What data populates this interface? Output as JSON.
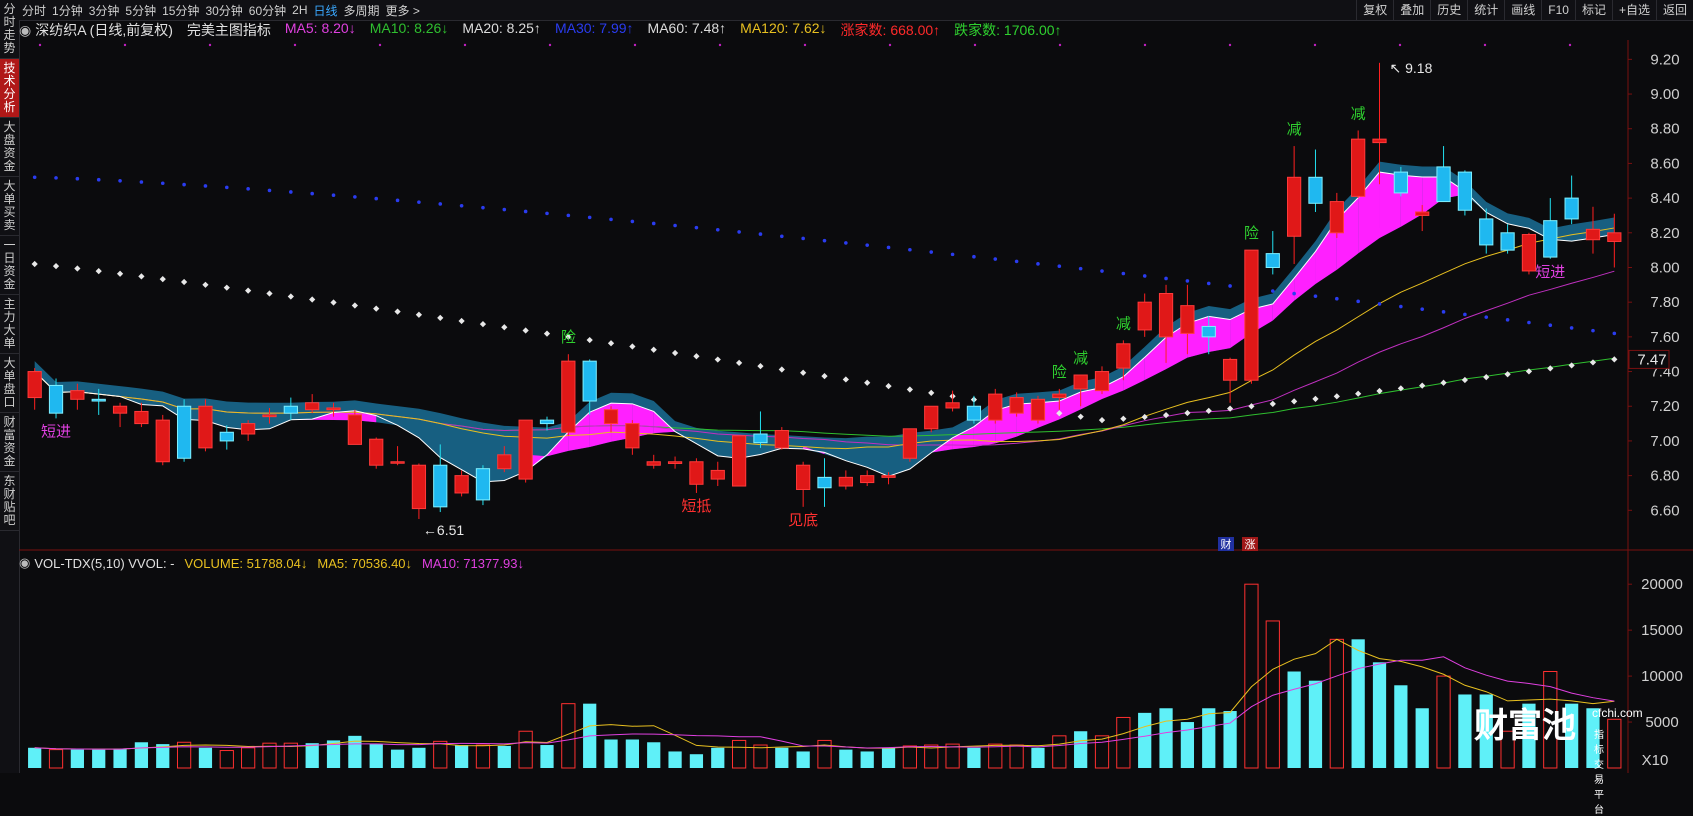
{
  "sidebar": {
    "items": [
      {
        "label": "分时走势",
        "active": false
      },
      {
        "label": "技术分析",
        "active": true
      },
      {
        "label": "大盘资金",
        "active": false
      },
      {
        "label": "大单买卖",
        "active": false
      },
      {
        "label": "一日资金",
        "active": false
      },
      {
        "label": "主力大单",
        "active": false
      },
      {
        "label": "大单盘口",
        "active": false
      },
      {
        "label": "财富资金",
        "active": false
      },
      {
        "label": "东财贴吧",
        "active": false
      }
    ]
  },
  "toolbar": {
    "periods": [
      "分时",
      "1分钟",
      "3分钟",
      "5分钟",
      "15分钟",
      "30分钟",
      "60分钟",
      "2H",
      "日线",
      "多周期",
      "更多 >"
    ],
    "active_period": "日线",
    "right_tools": [
      "复权",
      "叠加",
      "历史",
      "统计",
      "画线",
      "F10",
      "标记",
      "+自选",
      "返回"
    ]
  },
  "legend": {
    "stock": "深纺织A (日线,前复权)",
    "indicator": "完美主图指标",
    "items": [
      {
        "text": "MA5: 8.20↓",
        "color": "#e040e0"
      },
      {
        "text": "MA10: 8.26↓",
        "color": "#2fbf2f"
      },
      {
        "text": "MA20: 8.25↑",
        "color": "#dcdcdc"
      },
      {
        "text": "MA30: 7.99↑",
        "color": "#2a3cf0"
      },
      {
        "text": "MA60: 7.48↑",
        "color": "#dcdcdc"
      },
      {
        "text": "MA120: 7.62↓",
        "color": "#e8c020"
      },
      {
        "text": "涨家数: 668.00↑",
        "color": "#ff2a2a"
      },
      {
        "text": "跌家数: 1706.00↑",
        "color": "#2fd02f"
      }
    ]
  },
  "vol_legend": {
    "title": "VOL-TDX(5,10) VVOL: -",
    "items": [
      {
        "text": "VOLUME: 51788.04↓",
        "color": "#e8c020"
      },
      {
        "text": "MA5: 70536.40↓",
        "color": "#e8c020"
      },
      {
        "text": "MA10: 71377.93↓",
        "color": "#e040e0"
      }
    ]
  },
  "chart_data": [
    {
      "type": "candlestick",
      "ylim": [
        6.4,
        9.3
      ],
      "y_ticks": [
        "9.20",
        "9.00",
        "8.80",
        "8.60",
        "8.40",
        "8.20",
        "8.00",
        "7.80",
        "7.60",
        "7.40",
        "7.20",
        "7.00",
        "6.80",
        "6.60"
      ],
      "last_price_label": "7.47",
      "high_label": "9.18",
      "low_label": "6.51",
      "candles": [
        {
          "o": 7.25,
          "h": 7.42,
          "l": 7.18,
          "c": 7.4
        },
        {
          "o": 7.32,
          "h": 7.36,
          "l": 7.13,
          "c": 7.16
        },
        {
          "o": 7.24,
          "h": 7.33,
          "l": 7.18,
          "c": 7.29
        },
        {
          "o": 7.24,
          "h": 7.3,
          "l": 7.15,
          "c": 7.23
        },
        {
          "o": 7.16,
          "h": 7.22,
          "l": 7.08,
          "c": 7.2
        },
        {
          "o": 7.1,
          "h": 7.22,
          "l": 7.08,
          "c": 7.17
        },
        {
          "o": 6.88,
          "h": 7.15,
          "l": 6.86,
          "c": 7.12
        },
        {
          "o": 7.2,
          "h": 7.24,
          "l": 6.88,
          "c": 6.9
        },
        {
          "o": 6.96,
          "h": 7.24,
          "l": 6.94,
          "c": 7.2
        },
        {
          "o": 7.05,
          "h": 7.09,
          "l": 6.95,
          "c": 7.0
        },
        {
          "o": 7.04,
          "h": 7.12,
          "l": 7.0,
          "c": 7.1
        },
        {
          "o": 7.14,
          "h": 7.19,
          "l": 7.1,
          "c": 7.15
        },
        {
          "o": 7.2,
          "h": 7.25,
          "l": 7.12,
          "c": 7.16
        },
        {
          "o": 7.18,
          "h": 7.27,
          "l": 7.16,
          "c": 7.22
        },
        {
          "o": 7.18,
          "h": 7.22,
          "l": 7.14,
          "c": 7.19
        },
        {
          "o": 6.98,
          "h": 7.18,
          "l": 6.98,
          "c": 7.15
        },
        {
          "o": 6.86,
          "h": 7.02,
          "l": 6.84,
          "c": 7.01
        },
        {
          "o": 6.88,
          "h": 6.97,
          "l": 6.86,
          "c": 6.88
        },
        {
          "o": 6.61,
          "h": 6.87,
          "l": 6.55,
          "c": 6.86
        },
        {
          "o": 6.86,
          "h": 6.98,
          "l": 6.59,
          "c": 6.62
        },
        {
          "o": 6.7,
          "h": 6.83,
          "l": 6.68,
          "c": 6.8
        },
        {
          "o": 6.84,
          "h": 6.86,
          "l": 6.63,
          "c": 6.66
        },
        {
          "o": 6.84,
          "h": 6.97,
          "l": 6.82,
          "c": 6.92
        },
        {
          "o": 6.78,
          "h": 7.12,
          "l": 6.76,
          "c": 7.12
        },
        {
          "o": 7.12,
          "h": 7.14,
          "l": 7.06,
          "c": 7.1
        },
        {
          "o": 7.05,
          "h": 7.5,
          "l": 7.03,
          "c": 7.46
        },
        {
          "o": 7.46,
          "h": 7.47,
          "l": 7.15,
          "c": 7.23
        },
        {
          "o": 7.1,
          "h": 7.2,
          "l": 7.05,
          "c": 7.18
        },
        {
          "o": 6.96,
          "h": 7.12,
          "l": 6.92,
          "c": 7.1
        },
        {
          "o": 6.86,
          "h": 6.92,
          "l": 6.84,
          "c": 6.88
        },
        {
          "o": 6.87,
          "h": 6.91,
          "l": 6.84,
          "c": 6.88
        },
        {
          "o": 6.75,
          "h": 6.9,
          "l": 6.7,
          "c": 6.88
        },
        {
          "o": 6.78,
          "h": 6.88,
          "l": 6.74,
          "c": 6.83
        },
        {
          "o": 6.74,
          "h": 7.03,
          "l": 6.74,
          "c": 7.03
        },
        {
          "o": 7.04,
          "h": 7.17,
          "l": 6.96,
          "c": 6.99
        },
        {
          "o": 6.96,
          "h": 7.08,
          "l": 6.95,
          "c": 7.06
        },
        {
          "o": 6.72,
          "h": 6.88,
          "l": 6.62,
          "c": 6.86
        },
        {
          "o": 6.79,
          "h": 6.9,
          "l": 6.62,
          "c": 6.73
        },
        {
          "o": 6.74,
          "h": 6.83,
          "l": 6.72,
          "c": 6.79
        },
        {
          "o": 6.76,
          "h": 6.83,
          "l": 6.74,
          "c": 6.8
        },
        {
          "o": 6.79,
          "h": 6.82,
          "l": 6.75,
          "c": 6.8
        },
        {
          "o": 6.9,
          "h": 7.07,
          "l": 6.88,
          "c": 7.07
        },
        {
          "o": 7.07,
          "h": 7.2,
          "l": 7.05,
          "c": 7.2
        },
        {
          "o": 7.19,
          "h": 7.29,
          "l": 7.17,
          "c": 7.22
        },
        {
          "o": 7.2,
          "h": 7.26,
          "l": 7.1,
          "c": 7.12
        },
        {
          "o": 7.12,
          "h": 7.3,
          "l": 7.1,
          "c": 7.27
        },
        {
          "o": 7.16,
          "h": 7.28,
          "l": 7.14,
          "c": 7.25
        },
        {
          "o": 7.12,
          "h": 7.26,
          "l": 7.1,
          "c": 7.24
        },
        {
          "o": 7.25,
          "h": 7.3,
          "l": 7.18,
          "c": 7.27
        },
        {
          "o": 7.3,
          "h": 7.38,
          "l": 7.2,
          "c": 7.38
        },
        {
          "o": 7.29,
          "h": 7.43,
          "l": 7.27,
          "c": 7.4
        },
        {
          "o": 7.42,
          "h": 7.58,
          "l": 7.35,
          "c": 7.56
        },
        {
          "o": 7.64,
          "h": 7.85,
          "l": 7.6,
          "c": 7.8
        },
        {
          "o": 7.6,
          "h": 7.9,
          "l": 7.45,
          "c": 7.85
        },
        {
          "o": 7.62,
          "h": 7.9,
          "l": 7.5,
          "c": 7.78
        },
        {
          "o": 7.66,
          "h": 7.72,
          "l": 7.5,
          "c": 7.6
        },
        {
          "o": 7.35,
          "h": 7.48,
          "l": 7.22,
          "c": 7.47
        },
        {
          "o": 7.35,
          "h": 8.1,
          "l": 7.33,
          "c": 8.1
        },
        {
          "o": 8.08,
          "h": 8.21,
          "l": 7.96,
          "c": 8.0
        },
        {
          "o": 8.18,
          "h": 8.7,
          "l": 8.02,
          "c": 8.52
        },
        {
          "o": 8.52,
          "h": 8.68,
          "l": 8.32,
          "c": 8.37
        },
        {
          "o": 8.2,
          "h": 8.43,
          "l": 8.17,
          "c": 8.38
        },
        {
          "o": 8.41,
          "h": 8.79,
          "l": 8.4,
          "c": 8.74
        },
        {
          "o": 8.72,
          "h": 9.18,
          "l": 8.48,
          "c": 8.74
        },
        {
          "o": 8.55,
          "h": 8.58,
          "l": 8.41,
          "c": 8.43
        },
        {
          "o": 8.3,
          "h": 8.36,
          "l": 8.21,
          "c": 8.32
        },
        {
          "o": 8.58,
          "h": 8.7,
          "l": 8.4,
          "c": 8.38
        },
        {
          "o": 8.55,
          "h": 8.56,
          "l": 8.3,
          "c": 8.33
        },
        {
          "o": 8.28,
          "h": 8.34,
          "l": 8.08,
          "c": 8.13
        },
        {
          "o": 8.2,
          "h": 8.25,
          "l": 8.08,
          "c": 8.1
        },
        {
          "o": 7.98,
          "h": 8.2,
          "l": 7.96,
          "c": 8.19
        },
        {
          "o": 8.27,
          "h": 8.4,
          "l": 8.05,
          "c": 8.06
        },
        {
          "o": 8.4,
          "h": 8.53,
          "l": 8.25,
          "c": 8.28
        },
        {
          "o": 8.16,
          "h": 8.35,
          "l": 8.08,
          "c": 8.22
        },
        {
          "o": 8.15,
          "h": 8.31,
          "l": 8.0,
          "c": 8.2
        }
      ],
      "annotations": [
        {
          "i": 1,
          "text": "短进",
          "color": "#e040e0",
          "pos": "below"
        },
        {
          "i": 25,
          "text": "险",
          "color": "#2fd02f",
          "pos": "above"
        },
        {
          "i": 31,
          "text": "短抵",
          "color": "#ff3030",
          "pos": "below"
        },
        {
          "i": 36,
          "text": "见底",
          "color": "#ff3030",
          "pos": "below"
        },
        {
          "i": 48,
          "text": "险",
          "color": "#2fd02f",
          "pos": "above"
        },
        {
          "i": 49,
          "text": "减",
          "color": "#2fd02f",
          "pos": "above"
        },
        {
          "i": 51,
          "text": "减",
          "color": "#2fd02f",
          "pos": "above"
        },
        {
          "i": 57,
          "text": "险",
          "color": "#2fd02f",
          "pos": "above"
        },
        {
          "i": 59,
          "text": "减",
          "color": "#2fd02f",
          "pos": "above"
        },
        {
          "i": 62,
          "text": "减",
          "color": "#2fd02f",
          "pos": "above"
        },
        {
          "i": 71,
          "text": "短进",
          "color": "#e040e0",
          "pos": "below"
        }
      ],
      "markers": [
        "财",
        "涨"
      ]
    },
    {
      "type": "bar",
      "ylim": [
        0,
        21000
      ],
      "y_ticks": [
        "20000",
        "15000",
        "10000",
        "5000"
      ],
      "unit_label": "X10",
      "volumes": [
        [
          2200,
          0
        ],
        [
          2000,
          1
        ],
        [
          2000,
          0
        ],
        [
          2000,
          0
        ],
        [
          2100,
          0
        ],
        [
          2800,
          0
        ],
        [
          2600,
          0
        ],
        [
          2800,
          1
        ],
        [
          2200,
          0
        ],
        [
          1900,
          1
        ],
        [
          2200,
          1
        ],
        [
          2700,
          1
        ],
        [
          2700,
          1
        ],
        [
          2700,
          0
        ],
        [
          3000,
          0
        ],
        [
          3500,
          0
        ],
        [
          2600,
          0
        ],
        [
          2000,
          0
        ],
        [
          2200,
          0
        ],
        [
          2900,
          1
        ],
        [
          2500,
          0
        ],
        [
          2500,
          1
        ],
        [
          2400,
          0
        ],
        [
          4000,
          1
        ],
        [
          2500,
          0
        ],
        [
          7000,
          1
        ],
        [
          7000,
          0
        ],
        [
          3100,
          0
        ],
        [
          3100,
          0
        ],
        [
          2800,
          0
        ],
        [
          1800,
          0
        ],
        [
          1500,
          0
        ],
        [
          2200,
          0
        ],
        [
          3000,
          1
        ],
        [
          2500,
          1
        ],
        [
          2200,
          0
        ],
        [
          1800,
          0
        ],
        [
          3000,
          1
        ],
        [
          2000,
          0
        ],
        [
          1800,
          0
        ],
        [
          2200,
          0
        ],
        [
          2400,
          1
        ],
        [
          2500,
          1
        ],
        [
          2600,
          1
        ],
        [
          2200,
          0
        ],
        [
          2600,
          1
        ],
        [
          2500,
          1
        ],
        [
          2200,
          0
        ],
        [
          3500,
          1
        ],
        [
          4000,
          0
        ],
        [
          3500,
          1
        ],
        [
          5500,
          1
        ],
        [
          6000,
          0
        ],
        [
          6500,
          0
        ],
        [
          5000,
          0
        ],
        [
          6500,
          0
        ],
        [
          6200,
          0
        ],
        [
          20000,
          1
        ],
        [
          16000,
          1
        ],
        [
          10500,
          0
        ],
        [
          9500,
          0
        ],
        [
          14000,
          1
        ],
        [
          14000,
          0
        ],
        [
          11500,
          0
        ],
        [
          9000,
          0
        ],
        [
          6500,
          0
        ],
        [
          10000,
          1
        ],
        [
          8000,
          0
        ],
        [
          8000,
          0
        ],
        [
          4000,
          1
        ],
        [
          7000,
          0
        ],
        [
          10500,
          1
        ],
        [
          7000,
          0
        ],
        [
          6500,
          0
        ],
        [
          5300,
          1
        ]
      ]
    }
  ],
  "watermark": {
    "brand": "财富池",
    "domain": "cfchi.com",
    "tagline": "指标交易平台"
  }
}
